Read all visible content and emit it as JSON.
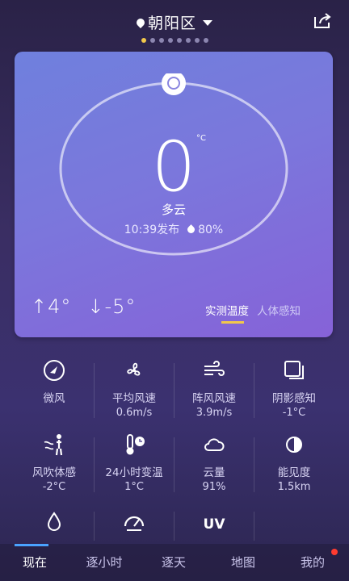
{
  "header": {
    "location": "朝阳区",
    "page_dots": 8,
    "active_dot": 1
  },
  "current": {
    "temperature": "0",
    "unit": "°C",
    "condition": "多云",
    "published": "10:39发布",
    "humidity": "80%",
    "high": "↑4°",
    "low": "↓-5°",
    "mode_active": "实测温度",
    "mode_other": "人体感知"
  },
  "details": [
    {
      "label": "微风",
      "value": "",
      "icon": "compass-icon"
    },
    {
      "label": "平均风速",
      "value": "0.6m/s",
      "icon": "fan-icon"
    },
    {
      "label": "阵风风速",
      "value": "3.9m/s",
      "icon": "wind-icon"
    },
    {
      "label": "阴影感知",
      "value": "-1°C",
      "icon": "shade-icon"
    },
    {
      "label": "风吹体感",
      "value": "-2°C",
      "icon": "person-wind-icon"
    },
    {
      "label": "24小时变温",
      "value": "1°C",
      "icon": "thermometer-clock-icon"
    },
    {
      "label": "云量",
      "value": "91%",
      "icon": "cloud-icon"
    },
    {
      "label": "能见度",
      "value": "1.5km",
      "icon": "visibility-icon"
    },
    {
      "label": "",
      "value": "",
      "icon": "water-drop-icon"
    },
    {
      "label": "",
      "value": "",
      "icon": "pressure-gauge-icon"
    },
    {
      "label": "UV",
      "value": "",
      "icon": "uv-icon"
    }
  ],
  "tabs": [
    {
      "label": "现在"
    },
    {
      "label": "逐小时"
    },
    {
      "label": "逐天"
    },
    {
      "label": "地图"
    },
    {
      "label": "我的"
    }
  ],
  "colors": {
    "accent_yellow": "#f2c84b",
    "tab_active": "#4aa3ff",
    "notification": "#ff3b30"
  }
}
